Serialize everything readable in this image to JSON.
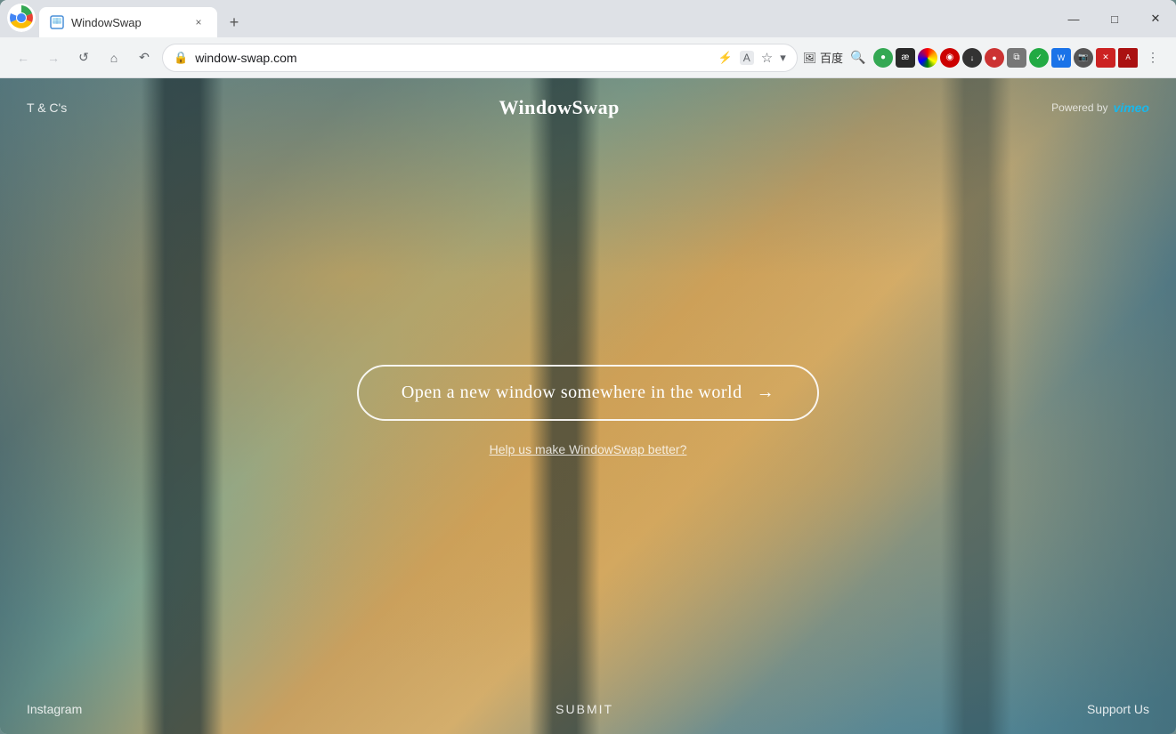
{
  "browser": {
    "tab": {
      "favicon": "🪟",
      "title": "WindowSwap",
      "close_label": "×"
    },
    "new_tab_label": "+",
    "window_controls": {
      "minimize": "—",
      "maximize": "□",
      "close": "✕"
    },
    "toolbar": {
      "back_label": "←",
      "forward_label": "→",
      "reload_label": "↺",
      "home_label": "⌂",
      "history_back_label": "↶",
      "bookmark_label": "☆",
      "url": "window-swap.com",
      "lock_icon": "🔒",
      "search_icon": "🔍",
      "bookmark_star": "⭐",
      "extensions_label": "⚡",
      "translate_label": "A",
      "baidu_text": "百度",
      "menu_label": "⋮"
    }
  },
  "site": {
    "tc_label": "T & C's",
    "title": "WindowSwap",
    "powered_by_label": "Powered by",
    "vimeo_label": "vimeo",
    "main_button_label": "Open a new window somewhere in the world",
    "main_button_arrow": "→",
    "help_link_label": "Help us make WindowSwap better?",
    "footer": {
      "instagram_label": "Instagram",
      "submit_label": "SUBMIT",
      "support_label": "Support Us"
    }
  },
  "colors": {
    "bg_primary": "#5a8a9a",
    "bg_warm": "#c8a060",
    "text_white": "#ffffff",
    "border_btn": "rgba(255,255,255,0.9)"
  }
}
